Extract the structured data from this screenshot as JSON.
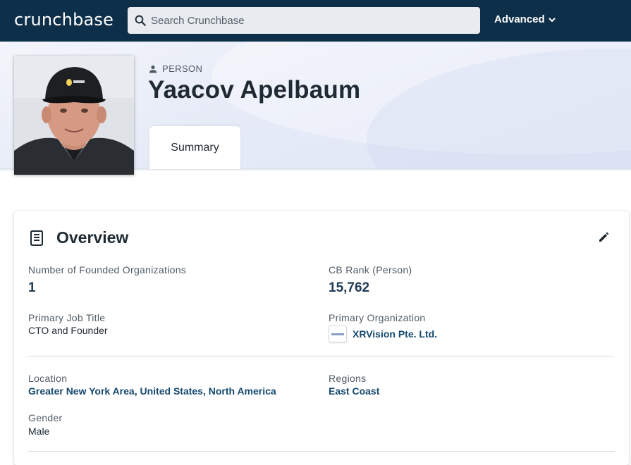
{
  "header": {
    "logo_text": "crunchbase",
    "search_placeholder": "Search Crunchbase",
    "advanced_label": "Advanced",
    "bar_color": "#0e2f4a"
  },
  "profile": {
    "type_label": "PERSON",
    "name": "Yaacov Apelbaum",
    "tabs": [
      {
        "label": "Summary",
        "active": true
      }
    ]
  },
  "overview": {
    "title": "Overview",
    "founded_orgs_label": "Number of Founded Organizations",
    "founded_orgs_value": "1",
    "cb_rank_label": "CB Rank (Person)",
    "cb_rank_value": "15,762",
    "job_title_label": "Primary Job Title",
    "job_title_value": "CTO and Founder",
    "primary_org_label": "Primary Organization",
    "primary_org_value": "XRVision Pte. Ltd.",
    "location_label": "Location",
    "location_parts": [
      "Greater New York Area",
      "United States",
      "North America"
    ],
    "regions_label": "Regions",
    "regions_value": "East Coast",
    "gender_label": "Gender",
    "gender_value": "Male"
  }
}
